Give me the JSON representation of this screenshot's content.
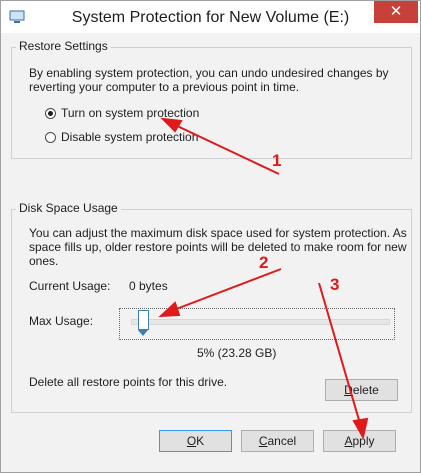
{
  "window": {
    "title": "System Protection for New Volume (E:)",
    "close_glyph": "✕"
  },
  "restore": {
    "legend": "Restore Settings",
    "description_line1": "By enabling system protection, you can undo undesired changes by",
    "description_line2": "reverting your computer to a previous point in time.",
    "option_on": "Turn on system protection",
    "option_off": "Disable system protection",
    "selected": "on"
  },
  "disk": {
    "legend": "Disk Space Usage",
    "description_line1": "You can adjust the maximum disk space used for system protection. As",
    "description_line2": "space fills up, older restore points will be deleted to make room for new",
    "description_line3": "ones.",
    "current_usage_label": "Current Usage:",
    "current_usage_value": "0 bytes",
    "max_usage_label": "Max Usage:",
    "max_usage_percent": 5,
    "max_usage_value": "5% (23.28 GB)",
    "delete_text": "Delete all restore points for this drive.",
    "delete_button": "Delete"
  },
  "buttons": {
    "ok": "OK",
    "cancel": "Cancel",
    "apply": "Apply"
  },
  "annotations": {
    "one": "1",
    "two": "2",
    "three": "3",
    "color": "#e0191b"
  }
}
